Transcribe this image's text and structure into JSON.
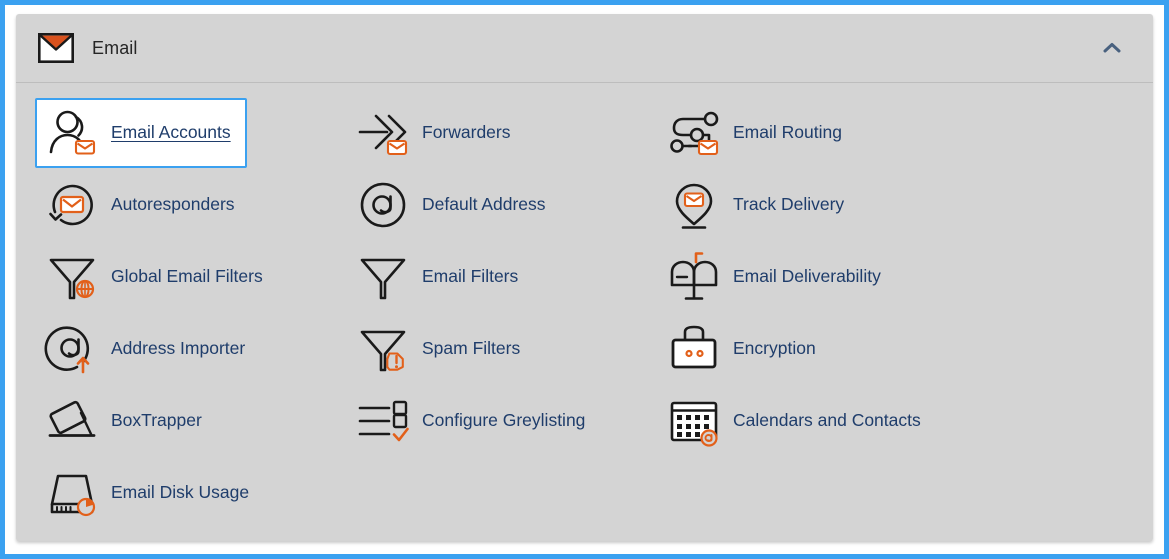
{
  "window": {
    "focus_border_color": "#3ba1f0",
    "panel_background": "#d4d4d4",
    "link_color": "#1f3d6b",
    "accent_color": "#e2601a"
  },
  "header": {
    "title": "Email",
    "icon": "envelope-icon",
    "collapse_icon": "chevron-up-icon",
    "collapse_state": "expanded"
  },
  "features": [
    {
      "label": "Email Accounts",
      "icon": "user-envelope-icon",
      "active": true
    },
    {
      "label": "Forwarders",
      "icon": "arrow-chevrons-envelope-icon",
      "active": false
    },
    {
      "label": "Email Routing",
      "icon": "routing-nodes-envelope-icon",
      "active": false
    },
    {
      "label": "Autoresponders",
      "icon": "loop-arrow-envelope-icon",
      "active": false
    },
    {
      "label": "Default Address",
      "icon": "at-circle-icon",
      "active": false
    },
    {
      "label": "Track Delivery",
      "icon": "map-pin-envelope-icon",
      "active": false
    },
    {
      "label": "Global Email Filters",
      "icon": "funnel-globe-icon",
      "active": false
    },
    {
      "label": "Email Filters",
      "icon": "funnel-icon",
      "active": false
    },
    {
      "label": "Email Deliverability",
      "icon": "mailbox-flag-icon",
      "active": false
    },
    {
      "label": "Address Importer",
      "icon": "at-circle-up-arrow-icon",
      "active": false
    },
    {
      "label": "Spam Filters",
      "icon": "funnel-alert-icon",
      "active": false
    },
    {
      "label": "Encryption",
      "icon": "padlock-icon",
      "active": false
    },
    {
      "label": "BoxTrapper",
      "icon": "box-trap-icon",
      "active": false
    },
    {
      "label": "Configure Greylisting",
      "icon": "checklist-check-icon",
      "active": false
    },
    {
      "label": "Calendars and Contacts",
      "icon": "calendar-at-icon",
      "active": false
    },
    {
      "label": "Email Disk Usage",
      "icon": "disk-pie-icon",
      "active": false
    }
  ]
}
